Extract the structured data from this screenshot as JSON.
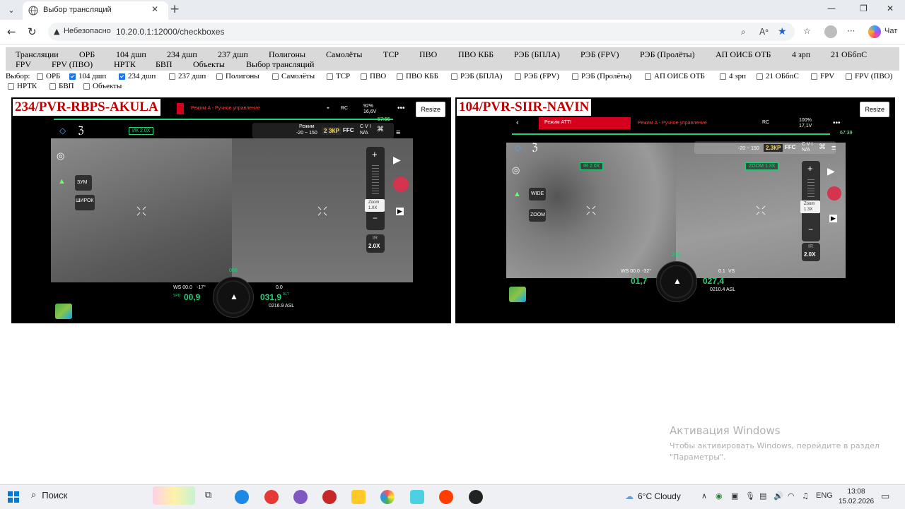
{
  "browser": {
    "tab_title": "Выбор трансляций",
    "insecure_label": "Небезопасно",
    "url": "10.20.0.1:12000/checkboxes",
    "chat_label": "Чат"
  },
  "nav": {
    "items": [
      "Трансляции",
      "ОРБ",
      "104 дшп",
      "234 дшп",
      "237 дшп",
      "Полигоны",
      "Самолёты",
      "ТСР",
      "ПВО",
      "ПВО КББ",
      "РЭБ (БПЛА)",
      "РЭБ (FPV)",
      "РЭБ (Пролёты)",
      "АП ОИСБ ОТБ",
      "4 зрп",
      "21 ОБбпС",
      "FPV",
      "FPV (ПВО)",
      "НРТК",
      "БВП",
      "Объекты",
      "Выбор трансляций"
    ]
  },
  "selection": {
    "label": "Выбор:",
    "items": [
      {
        "label": "ОРБ",
        "checked": false
      },
      {
        "label": "104 дшп",
        "checked": true
      },
      {
        "label": "234 дшп",
        "checked": true
      },
      {
        "label": "237 дшп",
        "checked": false
      },
      {
        "label": "Полигоны",
        "checked": false
      },
      {
        "label": "Самолёты",
        "checked": false
      },
      {
        "label": "ТСР",
        "checked": false
      },
      {
        "label": "ПВО",
        "checked": false
      },
      {
        "label": "ПВО КББ",
        "checked": false
      },
      {
        "label": "РЭБ (БПЛА)",
        "checked": false
      },
      {
        "label": "РЭБ (FPV)",
        "checked": false
      },
      {
        "label": "РЭБ (Пролёты)",
        "checked": false
      },
      {
        "label": "АП ОИСБ ОТБ",
        "checked": false
      },
      {
        "label": "4 зрп",
        "checked": false
      },
      {
        "label": "21 ОБбпС",
        "checked": false
      },
      {
        "label": "FPV",
        "checked": false
      },
      {
        "label": "FPV (ПВО)",
        "checked": false
      },
      {
        "label": "НРТК",
        "checked": false
      },
      {
        "label": "БВП",
        "checked": false
      },
      {
        "label": "Объекты",
        "checked": false
      }
    ]
  },
  "streams": [
    {
      "title": "234/PVR-RBPS-AKULA",
      "resize_label": "Resize",
      "mode_text": "Режим A - Ручное управление",
      "rc": "RC",
      "battery": "92%",
      "voltage": "16,6V",
      "timer": "57:56",
      "ir_zoom": "ИК 2.0X",
      "range_label": "Режим",
      "range_val": "-20 ~ 150",
      "tag_a": "2 ЗКР",
      "ffc": "FFC",
      "cvi": "C V I",
      "na": "N/A",
      "zoom_btn": "ЗУМ",
      "wide_btn": "ШИРОК",
      "zoom_val": "Zoom\n1.0X",
      "ir_label": "IR",
      "ir_val": "2.0X",
      "ws": "WS 00.0",
      "angle": "-17°",
      "speed": "00,9",
      "alt": "031,9",
      "vs": "0.0",
      "asl": "0216.9 ASL",
      "heading": "068",
      "spd_label": "SPD",
      "alt_label": "ALT"
    },
    {
      "title": "104/PVR-SIIR-NAVIN",
      "resize_label": "Resize",
      "mode_badge": "Режим ATTI",
      "mode_text": "Режим A - Ручное управление",
      "rc": "RC",
      "battery": "100%",
      "voltage": "17,1V",
      "timer": "67:39",
      "ir_zoom": "IR 2.0X",
      "zoom_box": "ZOOM 1.3X",
      "range_val": "-20 ~ 150",
      "tag_a": "2.3КР",
      "ffc": "FFC",
      "cvi": "C V I",
      "na": "N/A",
      "zoom_btn": "ZOOM",
      "wide_btn": "WIDE",
      "zoom_val": "Zoom\n1.3X",
      "ir_label": "IR",
      "ir_val": "2.0X",
      "ws": "WS 00.0",
      "angle": "-32°",
      "speed": "01,7",
      "alt": "027,4",
      "vs": "0.1",
      "asl": "0210.4 ASL",
      "heading": "238",
      "vs_label": "VS"
    }
  ],
  "watermark": {
    "title": "Активация Windows",
    "line1": "Чтобы активировать Windows, перейдите в раздел",
    "line2": "\"Параметры\"."
  },
  "taskbar": {
    "search_label": "Поиск",
    "weather": "6°C  Cloudy",
    "lang": "ENG",
    "time": "13:08",
    "date": "15.02.2026"
  }
}
